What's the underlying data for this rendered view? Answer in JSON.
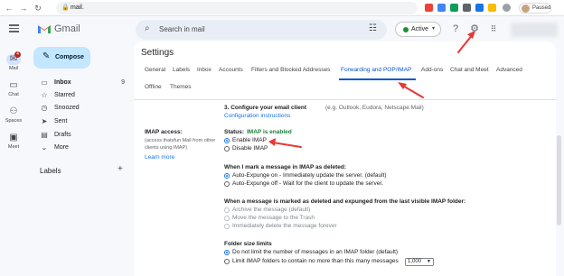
{
  "browser": {
    "url": "mail.",
    "profile_label": "Paused"
  },
  "header": {
    "app_name": "Gmail",
    "search_placeholder": "Search in mail",
    "status": "Active"
  },
  "rail": {
    "mail_label": "Mail",
    "mail_badge": "4",
    "chat_label": "Chat",
    "spaces_label": "Spaces",
    "meet_label": "Meet"
  },
  "nav": {
    "compose": "Compose",
    "items": [
      {
        "label": "Inbox",
        "count": "9"
      },
      {
        "label": "Starred",
        "count": ""
      },
      {
        "label": "Snoozed",
        "count": ""
      },
      {
        "label": "Sent",
        "count": ""
      },
      {
        "label": "Drafts",
        "count": ""
      },
      {
        "label": "More",
        "count": ""
      }
    ],
    "labels_header": "Labels"
  },
  "settings": {
    "title": "Settings",
    "tabs": [
      "General",
      "Labels",
      "Inbox",
      "Accounts",
      "Filters and Blocked Addresses",
      "Forwarding and POP/IMAP",
      "Add-ons",
      "Chat and Meet",
      "Advanced",
      "Offline",
      "Themes"
    ],
    "active_tab": "Forwarding and POP/IMAP",
    "configure_heading": "3. Configure your email client",
    "configure_note": "(e.g. Outlook, Eudora, Netscape Mail)",
    "configure_link": "Configuration instructions",
    "imap_label": "IMAP access:",
    "imap_sub1": "(access thatsfun Mail from other",
    "imap_sub2": "clients using IMAP)",
    "learn_more": "Learn more",
    "status_prefix": "Status:",
    "status_value": "IMAP is enabled",
    "enable_imap": "Enable IMAP",
    "disable_imap": "Disable IMAP",
    "deleted_heading": "When I mark a message in IMAP as deleted:",
    "expunge_on": "Auto-Expunge on - Immediately update the server. (default)",
    "expunge_off": "Auto-Expunge off - Wait for the client to update the server.",
    "expunged_heading": "When a message is marked as deleted and expunged from the last visible IMAP folder:",
    "archive_option": "Archive the message (default)",
    "trash_option": "Move the message to the Trash",
    "delete_option": "Immediately delete the message forever",
    "folder_heading": "Folder size limits",
    "no_limit": "Do not limit the number of messages in an IMAP folder (default)",
    "limit_folders": "Limit IMAP folders to contain no more than this many messages",
    "limit_value": "1,000"
  },
  "colors": {
    "accent": "#0b57d0",
    "annotation": "#e53935",
    "status_green": "#188038",
    "compose_bg": "#c2e7ff"
  }
}
